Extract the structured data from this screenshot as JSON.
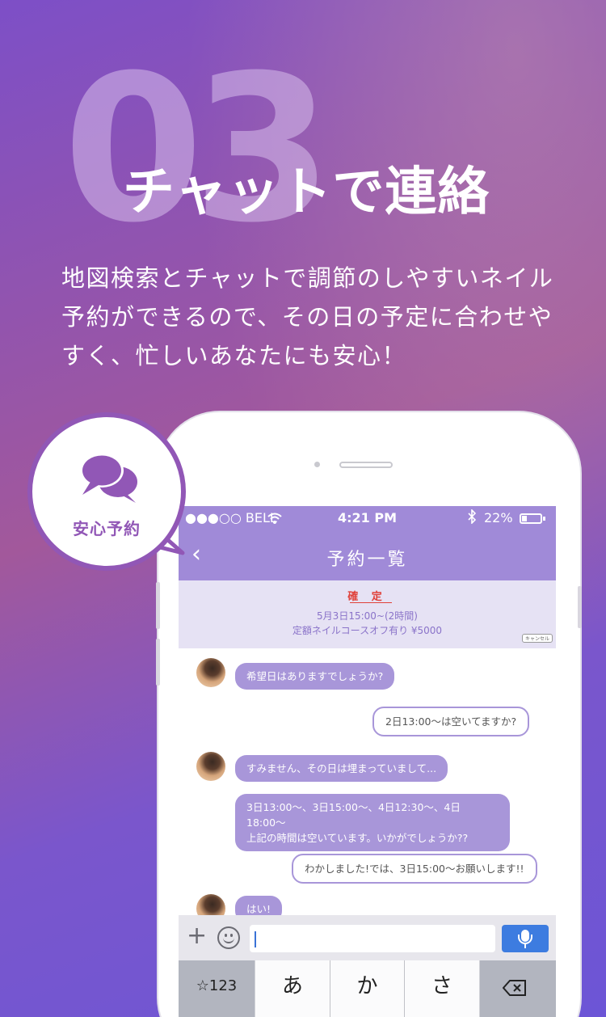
{
  "step_number": "03",
  "headline": "チャットで連絡",
  "description": "地図検索とチャットで調節のしやすいネイル予約ができるので、その日の予定に合わせやすく、忙しいあなたにも安心！",
  "badge": {
    "label": "安心予約",
    "icon": "chat-bubbles-icon"
  },
  "colors": {
    "accent": "#9157b6",
    "nav": "#a08ad8",
    "bubble": "#a896d9",
    "confirm_text": "#e0413a",
    "mic": "#3d7ce0"
  },
  "phone": {
    "status_bar": {
      "carrier": "●●●○○ BELL",
      "time": "4:21 PM",
      "battery": "22%"
    },
    "nav": {
      "back": "‹",
      "title": "予約一覧"
    },
    "reservation": {
      "status": "確 定",
      "datetime": "5月3日15:00~(2時間)",
      "course": "定額ネイルコースオフ有り ¥5000",
      "cancel": "キャンセル"
    },
    "messages": [
      {
        "side": "left",
        "text": "希望日はありますでしょうか?"
      },
      {
        "side": "right",
        "text": "2日13:00〜は空いてますか?"
      },
      {
        "side": "left",
        "text": "すみません、その日は埋まっていまして..."
      },
      {
        "side": "left",
        "text": "3日13:00〜、3日15:00〜、4日12:30〜、4日18:00〜\n上記の時間は空いています。いかがでしょうか??"
      },
      {
        "side": "right",
        "text": "わかしました!では、3日15:00〜お願いします!!"
      },
      {
        "side": "left",
        "text": "はい!"
      }
    ],
    "input": {
      "plus": "+",
      "placeholder": ""
    },
    "keyboard": {
      "num_key": "☆123",
      "keys": [
        "あ",
        "か",
        "さ"
      ]
    }
  }
}
